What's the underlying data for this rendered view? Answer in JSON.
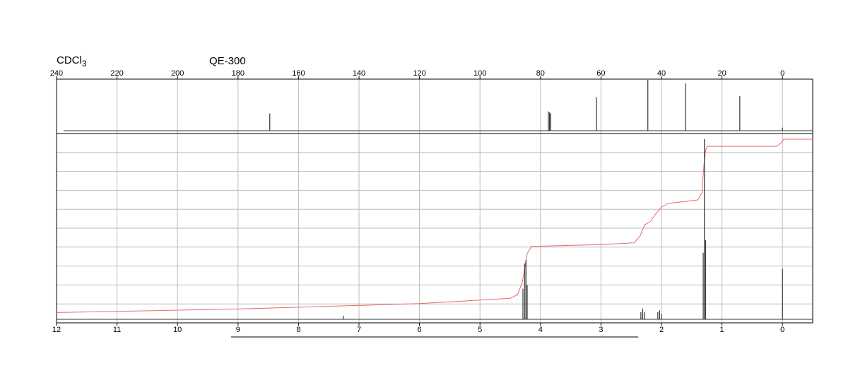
{
  "header": {
    "solvent_main": "CDCl",
    "solvent_sub": "3",
    "instrument": "QE-300"
  },
  "chart_data": [
    {
      "type": "line",
      "name": "13C NMR spectrum",
      "xlim": [
        240,
        -10
      ],
      "x_ticks": [
        240,
        220,
        200,
        180,
        160,
        140,
        120,
        100,
        80,
        60,
        40,
        20,
        0
      ],
      "grid": true,
      "baseline": 0,
      "peaks": [
        {
          "x": 169.5,
          "y": 0.34
        },
        {
          "x": 77.4,
          "y": 0.38
        },
        {
          "x": 77.0,
          "y": 0.36
        },
        {
          "x": 76.6,
          "y": 0.34
        },
        {
          "x": 61.5,
          "y": 0.66
        },
        {
          "x": 44.5,
          "y": 1.0
        },
        {
          "x": 32.0,
          "y": 0.93
        },
        {
          "x": 14.1,
          "y": 0.68
        },
        {
          "x": 0.0,
          "y": 0.06
        }
      ]
    },
    {
      "type": "line",
      "name": "1H NMR spectrum",
      "xlim": [
        12,
        -0.5
      ],
      "x_ticks": [
        12,
        11,
        10,
        9,
        8,
        7,
        6,
        5,
        4,
        3,
        2,
        1,
        0
      ],
      "grid": true,
      "baseline": 0,
      "peaks": [
        {
          "x": 4.29,
          "y": 0.17
        },
        {
          "x": 4.26,
          "y": 0.31
        },
        {
          "x": 4.24,
          "y": 0.33
        },
        {
          "x": 4.22,
          "y": 0.19
        },
        {
          "x": 7.26,
          "y": 0.02
        },
        {
          "x": 2.34,
          "y": 0.04
        },
        {
          "x": 2.31,
          "y": 0.06
        },
        {
          "x": 2.28,
          "y": 0.04
        },
        {
          "x": 2.06,
          "y": 0.04
        },
        {
          "x": 2.03,
          "y": 0.05
        },
        {
          "x": 2.0,
          "y": 0.03
        },
        {
          "x": 1.31,
          "y": 0.37
        },
        {
          "x": 1.29,
          "y": 1.0
        },
        {
          "x": 1.27,
          "y": 0.44
        },
        {
          "x": 0.0,
          "y": 0.28
        }
      ],
      "integral_color": "#e86a6a",
      "integral": [
        {
          "x": 12.0,
          "y": 0.03
        },
        {
          "x": 9.0,
          "y": 0.05
        },
        {
          "x": 6.0,
          "y": 0.08
        },
        {
          "x": 4.5,
          "y": 0.11
        },
        {
          "x": 4.38,
          "y": 0.13
        },
        {
          "x": 4.3,
          "y": 0.2
        },
        {
          "x": 4.22,
          "y": 0.36
        },
        {
          "x": 4.15,
          "y": 0.4
        },
        {
          "x": 3.0,
          "y": 0.41
        },
        {
          "x": 2.45,
          "y": 0.42
        },
        {
          "x": 2.35,
          "y": 0.46
        },
        {
          "x": 2.28,
          "y": 0.52
        },
        {
          "x": 2.18,
          "y": 0.54
        },
        {
          "x": 2.1,
          "y": 0.58
        },
        {
          "x": 2.0,
          "y": 0.62
        },
        {
          "x": 1.9,
          "y": 0.64
        },
        {
          "x": 1.4,
          "y": 0.66
        },
        {
          "x": 1.33,
          "y": 0.7
        },
        {
          "x": 1.3,
          "y": 0.85
        },
        {
          "x": 1.27,
          "y": 0.94
        },
        {
          "x": 1.24,
          "y": 0.96
        },
        {
          "x": 0.1,
          "y": 0.96
        },
        {
          "x": 0.02,
          "y": 0.98
        },
        {
          "x": -0.02,
          "y": 1.0
        },
        {
          "x": -0.5,
          "y": 1.0
        }
      ]
    }
  ]
}
